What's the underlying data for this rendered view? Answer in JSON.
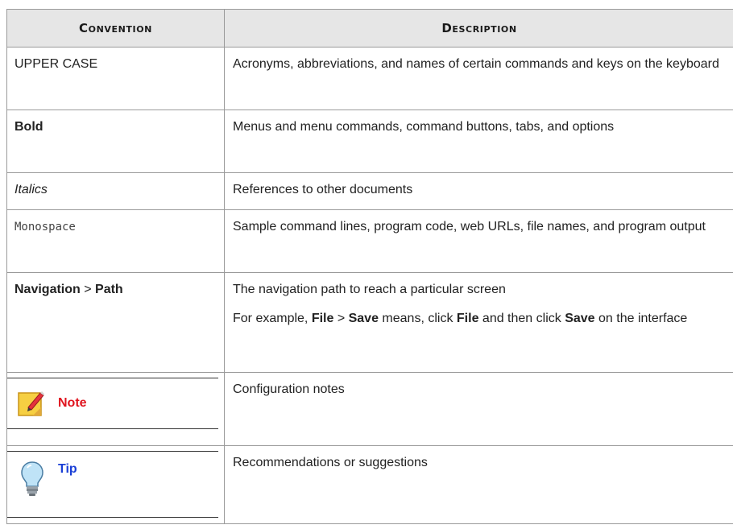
{
  "table": {
    "headers": [
      "Convention",
      "Description"
    ],
    "rows": {
      "upper": {
        "convention": "UPPER CASE",
        "description": "Acronyms, abbreviations, and names of certain commands and keys on the keyboard"
      },
      "bold": {
        "convention": "Bold",
        "description": "Menus and menu commands, command buttons, tabs, and options"
      },
      "italics": {
        "convention": "Italics",
        "description": "References to other documents"
      },
      "mono": {
        "convention": "Monospace",
        "description": "Sample command lines, program code, web URLs, file names, and program output"
      },
      "nav": {
        "conv_part1": "Navigation",
        "conv_sep": " > ",
        "conv_part2": "Path",
        "desc_line1": "The navigation path to reach a particular screen",
        "ex_prefix": "For example, ",
        "ex_file": "File",
        "ex_sep": " > ",
        "ex_save": "Save",
        "ex_mid": " means, click ",
        "ex_file2": "File",
        "ex_mid2": " and then click ",
        "ex_save2": "Save",
        "ex_suffix": " on the interface"
      },
      "note": {
        "label": "Note",
        "description": "Configuration notes",
        "icon": "note-pencil-icon",
        "color": "#e0141e"
      },
      "tip": {
        "label": "Tip",
        "description": "Recommendations or suggestions",
        "icon": "lightbulb-icon",
        "color": "#1a3fd6"
      }
    }
  }
}
